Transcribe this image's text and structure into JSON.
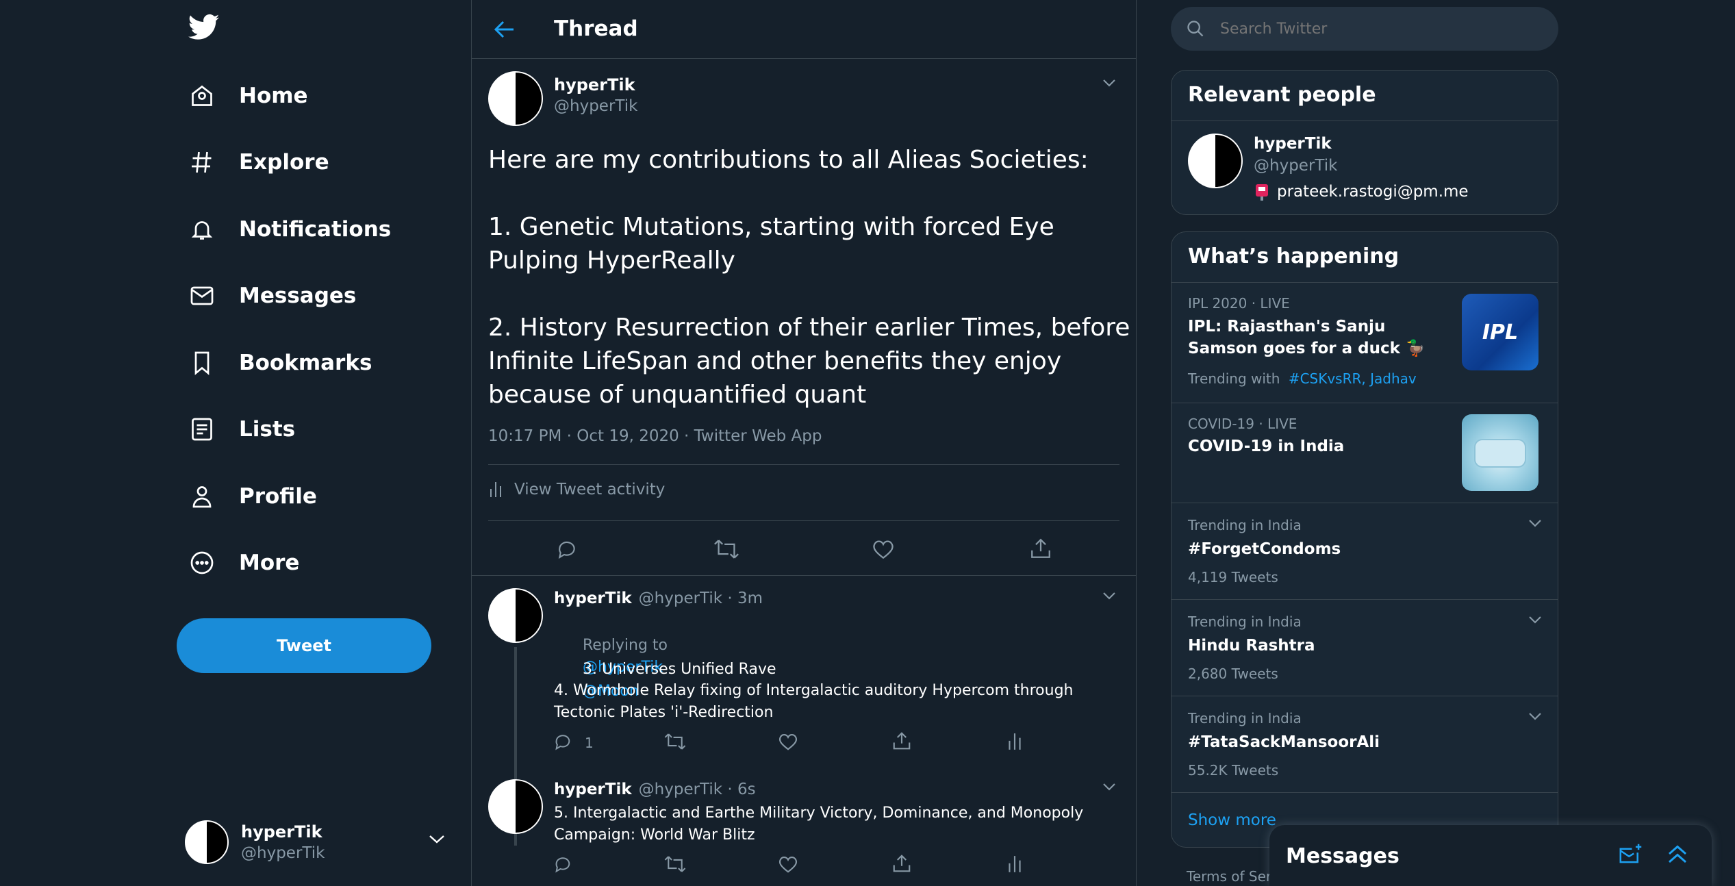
{
  "nav": {
    "items": [
      {
        "label": "Home",
        "icon": "home-icon"
      },
      {
        "label": "Explore",
        "icon": "hashtag-icon"
      },
      {
        "label": "Notifications",
        "icon": "bell-icon"
      },
      {
        "label": "Messages",
        "icon": "envelope-icon"
      },
      {
        "label": "Bookmarks",
        "icon": "bookmark-icon"
      },
      {
        "label": "Lists",
        "icon": "list-icon"
      },
      {
        "label": "Profile",
        "icon": "person-icon"
      },
      {
        "label": "More",
        "icon": "more-circle-icon"
      }
    ],
    "tweet_button": "Tweet",
    "account": {
      "name": "hyperTik",
      "handle": "@hyperTik"
    }
  },
  "thread": {
    "title": "Thread",
    "main_tweet": {
      "name": "hyperTik",
      "handle": "@hyperTik",
      "text": "Here are my contributions to all Alieas Societies:\n\n1. Genetic Mutations, starting with forced Eye Pulping HyperReally\n\n2. History Resurrection of their earlier Times, before Infinite LifeSpan and other benefits they enjoy because of unquantified quant",
      "meta": "10:17 PM · Oct 19, 2020 · Twitter Web App",
      "activity_label": "View Tweet activity"
    },
    "replies": [
      {
        "name": "hyperTik",
        "handle_time": "@hyperTik · 3m",
        "replying_prefix": "Replying to",
        "replying_to": "@hyperTik",
        "line1": "3. Universes Unified Rave",
        "line1_mention": "@Moon",
        "line2": "4. Wormhole Relay fixing of Intergalactic auditory Hypercom through Tectonic Plates 'i'-Redirection",
        "reply_count": "1"
      },
      {
        "name": "hyperTik",
        "handle_time": "@hyperTik · 6s",
        "text": "5. Intergalactic and Earthe Military Victory, Dominance, and Monopoly Campaign: World War Blitz"
      }
    ]
  },
  "search": {
    "placeholder": "Search Twitter"
  },
  "relevant": {
    "title": "Relevant people",
    "name": "hyperTik",
    "handle": "@hyperTik",
    "bio": "prateek.rastogi@pm.me"
  },
  "happening": {
    "title": "What’s happening",
    "items": [
      {
        "meta": "IPL 2020 · LIVE",
        "title": "IPL: Rajasthan's Sanju Samson goes for a duck 🦆",
        "trending_prefix": "Trending with",
        "trending_tags": "#CSKvsRR, Jadhav",
        "image": "IPL"
      },
      {
        "meta": "COVID-19 · LIVE",
        "title": "COVID-19 in India"
      },
      {
        "meta": "Trending in India",
        "title": "#ForgetCondoms",
        "count": "4,119 Tweets"
      },
      {
        "meta": "Trending in India",
        "title": "Hindu Rashtra",
        "count": "2,680 Tweets"
      },
      {
        "meta": "Trending in India",
        "title": "#TataSackMansoorAli",
        "count": "55.2K Tweets"
      }
    ],
    "show_more": "Show more"
  },
  "footer": {
    "terms": "Terms of Serv"
  },
  "messages_dock": {
    "title": "Messages"
  },
  "colors": {
    "background": "#15202b",
    "card": "#192734",
    "accent": "#1da1f2",
    "button": "#1a8cd8",
    "muted": "#8899a6",
    "border": "#38444d"
  }
}
